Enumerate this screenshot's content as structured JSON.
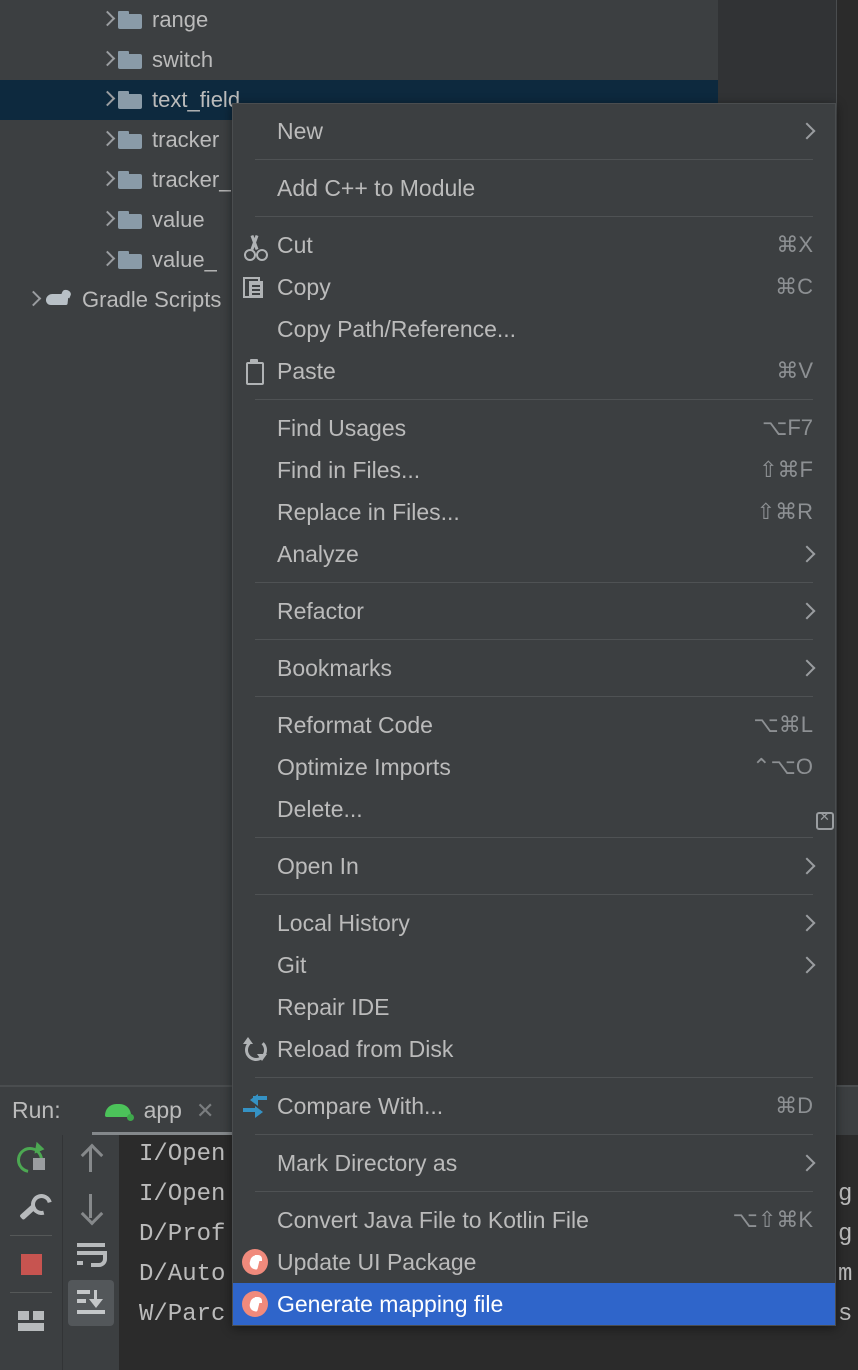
{
  "project_tree": {
    "items": [
      {
        "label": "range",
        "icon": "folder-icon",
        "selected": false
      },
      {
        "label": "switch",
        "icon": "folder-icon",
        "selected": false
      },
      {
        "label": "text_field",
        "icon": "folder-icon",
        "selected": true
      },
      {
        "label": "tracker",
        "icon": "folder-icon",
        "selected": false
      },
      {
        "label": "tracker_",
        "icon": "folder-icon",
        "selected": false
      },
      {
        "label": "value",
        "icon": "folder-icon",
        "selected": false
      },
      {
        "label": "value_",
        "icon": "folder-icon",
        "selected": false
      },
      {
        "label": "Gradle Scripts",
        "icon": "gradle-icon",
        "selected": false
      }
    ]
  },
  "run_panel": {
    "title": "Run:",
    "tab_label": "app",
    "tab_close": "✕",
    "console_lines": [
      "I/Open",
      "I/Open",
      "D/Prof",
      "D/Auto",
      "W/Parc"
    ],
    "console_right_fragments": [
      "",
      "g",
      "g",
      "m",
      "s"
    ],
    "toolbar_left": [
      {
        "name": "rerun-button",
        "icon": "rerun-icon"
      },
      {
        "name": "edit-configuration-button",
        "icon": "wrench-icon"
      },
      {
        "name": "stop-button",
        "icon": "stop-icon"
      },
      {
        "name": "layout-settings-button",
        "icon": "layout-icon"
      }
    ],
    "toolbar_right": [
      {
        "name": "up-button",
        "icon": "arrow-up-icon"
      },
      {
        "name": "down-button",
        "icon": "arrow-down-icon"
      },
      {
        "name": "soft-wrap-button",
        "icon": "wrap-icon"
      },
      {
        "name": "scroll-to-end-button",
        "icon": "scroll-to-end-icon",
        "active": true
      }
    ]
  },
  "context_menu": {
    "groups": [
      [
        {
          "label": "New",
          "icon": null,
          "accel": null,
          "submenu": true
        }
      ],
      [
        {
          "label": "Add C++ to Module",
          "icon": null,
          "accel": null,
          "submenu": false
        }
      ],
      [
        {
          "label": "Cut",
          "icon": "cut-icon",
          "accel": "⌘X",
          "submenu": false
        },
        {
          "label": "Copy",
          "icon": "copy-icon",
          "accel": "⌘C",
          "submenu": false
        },
        {
          "label": "Copy Path/Reference...",
          "icon": null,
          "accel": null,
          "submenu": false
        },
        {
          "label": "Paste",
          "icon": "paste-icon",
          "accel": "⌘V",
          "submenu": false
        }
      ],
      [
        {
          "label": "Find Usages",
          "icon": null,
          "accel": "⌥F7",
          "submenu": false
        },
        {
          "label": "Find in Files...",
          "icon": null,
          "accel": "⇧⌘F",
          "submenu": false
        },
        {
          "label": "Replace in Files...",
          "icon": null,
          "accel": "⇧⌘R",
          "submenu": false
        },
        {
          "label": "Analyze",
          "icon": null,
          "accel": null,
          "submenu": true
        }
      ],
      [
        {
          "label": "Refactor",
          "icon": null,
          "accel": null,
          "submenu": true
        }
      ],
      [
        {
          "label": "Bookmarks",
          "icon": null,
          "accel": null,
          "submenu": true
        }
      ],
      [
        {
          "label": "Reformat Code",
          "icon": null,
          "accel": "⌥⌘L",
          "submenu": false
        },
        {
          "label": "Optimize Imports",
          "icon": null,
          "accel": "⌃⌥O",
          "submenu": false
        },
        {
          "label": "Delete...",
          "icon": null,
          "accel": "delete-icon",
          "submenu": false,
          "accel_is_icon": true
        }
      ],
      [
        {
          "label": "Open In",
          "icon": null,
          "accel": null,
          "submenu": true
        }
      ],
      [
        {
          "label": "Local History",
          "icon": null,
          "accel": null,
          "submenu": true
        },
        {
          "label": "Git",
          "icon": null,
          "accel": null,
          "submenu": true
        },
        {
          "label": "Repair IDE",
          "icon": null,
          "accel": null,
          "submenu": false
        },
        {
          "label": "Reload from Disk",
          "icon": "reload-icon",
          "accel": null,
          "submenu": false
        }
      ],
      [
        {
          "label": "Compare With...",
          "icon": "compare-icon",
          "accel": "⌘D",
          "submenu": false
        }
      ],
      [
        {
          "label": "Mark Directory as",
          "icon": null,
          "accel": null,
          "submenu": true
        }
      ],
      [
        {
          "label": "Convert Java File to Kotlin File",
          "icon": null,
          "accel": "⌥⇧⌘K",
          "submenu": false
        },
        {
          "label": "Update UI Package",
          "icon": "kotlin-plugin-icon",
          "accel": null,
          "submenu": false
        },
        {
          "label": "Generate mapping file",
          "icon": "kotlin-plugin-icon",
          "accel": null,
          "submenu": false,
          "highlighted": true
        }
      ]
    ]
  },
  "colors": {
    "menu_bg": "#3c3f41",
    "panel_bg": "#3c3f41",
    "editor_bg": "#2b2b2b",
    "selection_tree": "#0d293e",
    "highlight": "#2f65ca",
    "text": "#bbbbbb",
    "accel_text": "#8d9093",
    "kotlin_icon": "#f08a7c",
    "compare_icon": "#3592c4",
    "rerun_icon": "#4ca852",
    "stop_icon": "#c75450",
    "android_icon": "#4cc35a"
  }
}
